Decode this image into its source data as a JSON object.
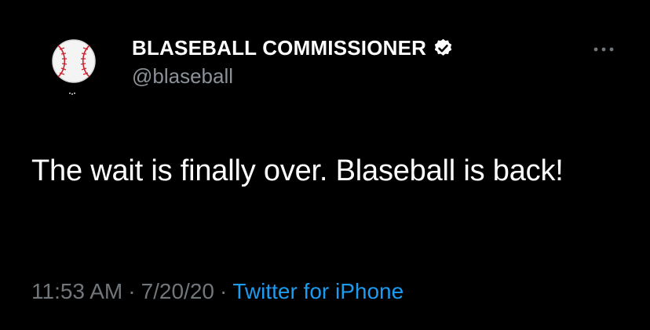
{
  "tweet": {
    "author": {
      "display_name": "BLASEBALL COMMISSIONER",
      "handle": "@blaseball",
      "verified": true,
      "avatar_icon": "baseball-icon"
    },
    "more_icon": "more-horizontal-icon",
    "text": "The wait is finally over. Blaseball is back!",
    "meta": {
      "time": "11:53 AM",
      "separator": "·",
      "date": "7/20/20",
      "source": "Twitter for iPhone"
    }
  },
  "colors": {
    "background": "#000000",
    "text": "#ffffff",
    "secondary": "#71767b",
    "link": "#1d9bf0"
  }
}
